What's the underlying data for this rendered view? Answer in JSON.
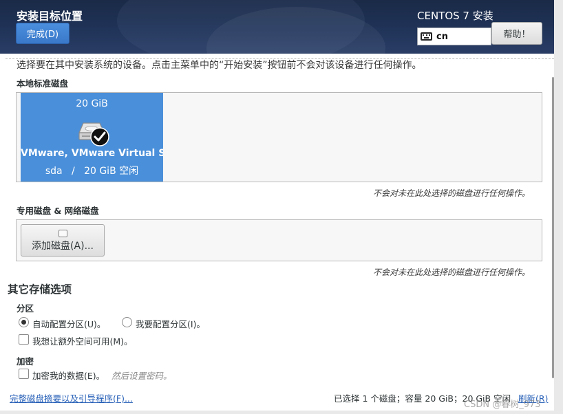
{
  "header": {
    "title": "安装目标位置",
    "done_button": "完成(D)",
    "product": "CENTOS 7 安装",
    "keyboard_layout": "cn",
    "help_button": "帮助！"
  },
  "instructions": "选择要在其中安装系统的设备。点击主菜单中的“开始安装”按钮前不会对该设备进行任何操作。",
  "local_disks": {
    "heading": "本地标准磁盘",
    "disks": [
      {
        "size": "20 GiB",
        "name": "VMware, VMware Virtual S",
        "device": "sda",
        "separator": "/",
        "free": "20 GiB 空闲",
        "selected": true
      }
    ],
    "note": "不会对未在此处选择的磁盘进行任何操作。"
  },
  "network_disks": {
    "heading": "专用磁盘 & 网络磁盘",
    "add_button": "添加磁盘(A)...",
    "note": "不会对未在此处选择的磁盘进行任何操作。"
  },
  "other_options": {
    "heading": "其它存储选项",
    "partitioning": {
      "heading": "分区",
      "auto_label": "自动配置分区(U)。",
      "auto_checked": true,
      "manual_label": "我要配置分区(I)。",
      "manual_checked": false,
      "extra_space_label": "我想让额外空间可用(M)。",
      "extra_space_checked": false
    },
    "encryption": {
      "heading": "加密",
      "encrypt_label": "加密我的数据(E)。",
      "encrypt_checked": false,
      "hint": "然后设置密码。"
    }
  },
  "footer": {
    "summary_link": "完整磁盘摘要以及引导程序(F)...",
    "status": "已选择 1 个磁盘；容量 20 GiB；20 GiB 空闲",
    "refresh_link": "刷新(R)"
  },
  "watermark": "CSDN @春树_973",
  "colors": {
    "header_bg": "#203358",
    "accent_blue": "#4a8fd9",
    "link": "#2a62b8"
  }
}
